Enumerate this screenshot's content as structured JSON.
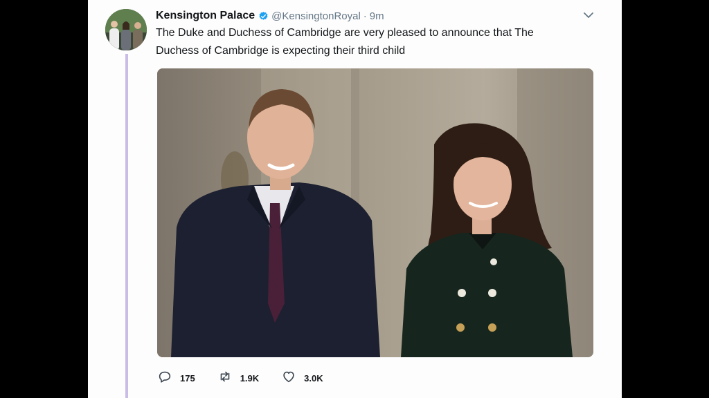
{
  "tweet": {
    "author_name": "Kensington Palace",
    "handle": "@KensingtonRoyal",
    "separator": "·",
    "time": "9m",
    "text_lines": [
      "The Duke and Duchess of Cambridge are very pleased to announce that The",
      "Duchess of Cambridge is expecting their third child"
    ],
    "verified_color": "#1da1f2",
    "thread_line_color": "#c9bde8"
  },
  "actions": {
    "reply_count": "175",
    "retweet_count": "1.9K",
    "like_count": "3.0K"
  },
  "icons": [
    "avatar",
    "verified-badge-icon",
    "chevron-down-icon",
    "reply-icon",
    "retweet-icon",
    "like-icon"
  ]
}
